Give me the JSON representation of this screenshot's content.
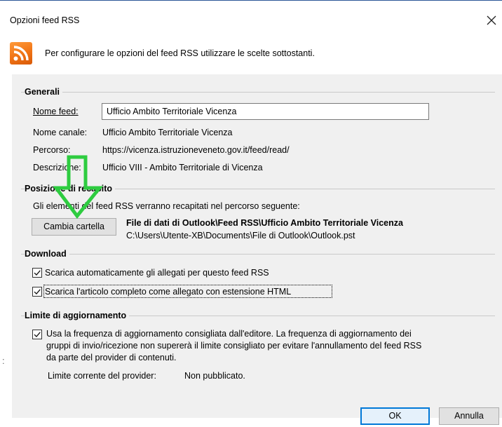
{
  "window": {
    "title": "Opzioni feed RSS",
    "icons": {
      "close": "close-icon",
      "rss": "rss-icon"
    },
    "header_text": "Per configurare le opzioni del feed RSS utilizzare le scelte sottostanti."
  },
  "generali": {
    "legend": "Generali",
    "nome_feed_label": "Nome feed:",
    "nome_feed_value": "Ufficio Ambito Territoriale Vicenza",
    "nome_canale_label": "Nome canale:",
    "nome_canale_value": "Ufficio Ambito Territoriale Vicenza",
    "percorso_label": "Percorso:",
    "percorso_value": "https://vicenza.istruzioneveneto.gov.it/feed/read/",
    "descrizione_label": "Descrizione:",
    "descrizione_value": "Ufficio VIII - Ambito Territoriale di Vicenza"
  },
  "recapito": {
    "legend": "Posizione di recapito",
    "info": "Gli elementi del feed RSS verranno recapitati nel percorso seguente:",
    "button_label": "Cambia cartella",
    "folder_bold": "File di dati di Outlook\\Feed RSS\\Ufficio Ambito Territoriale Vicenza",
    "folder_path": "C:\\Users\\Utente-XB\\Documents\\File di Outlook\\Outlook.pst"
  },
  "download": {
    "legend": "Download",
    "option1": "Scarica automaticamente gli allegati per questo feed RSS",
    "option1_checked": true,
    "option2": "Scarica l'articolo completo come allegato con estensione HTML",
    "option2_checked": true
  },
  "limite": {
    "legend": "Limite di aggiornamento",
    "option_line1": "Usa la frequenza di aggiornamento consigliata dall'editore. La frequenza di aggiornamento dei",
    "option_line2": "gruppi di invio/ricezione non supererà il limite consigliato per evitare l'annullamento del feed RSS",
    "option_line3": "da parte del provider di contenuti.",
    "option_checked": true,
    "provider_label": "Limite corrente del provider:",
    "provider_value": "Non pubblicato."
  },
  "buttons": {
    "ok": "OK",
    "cancel": "Annulla"
  },
  "annotation": {
    "arrow_color": "#2ecc40",
    "left_mark": ":"
  },
  "colors": {
    "rss": "#f07315",
    "accent": "#0078d7"
  }
}
